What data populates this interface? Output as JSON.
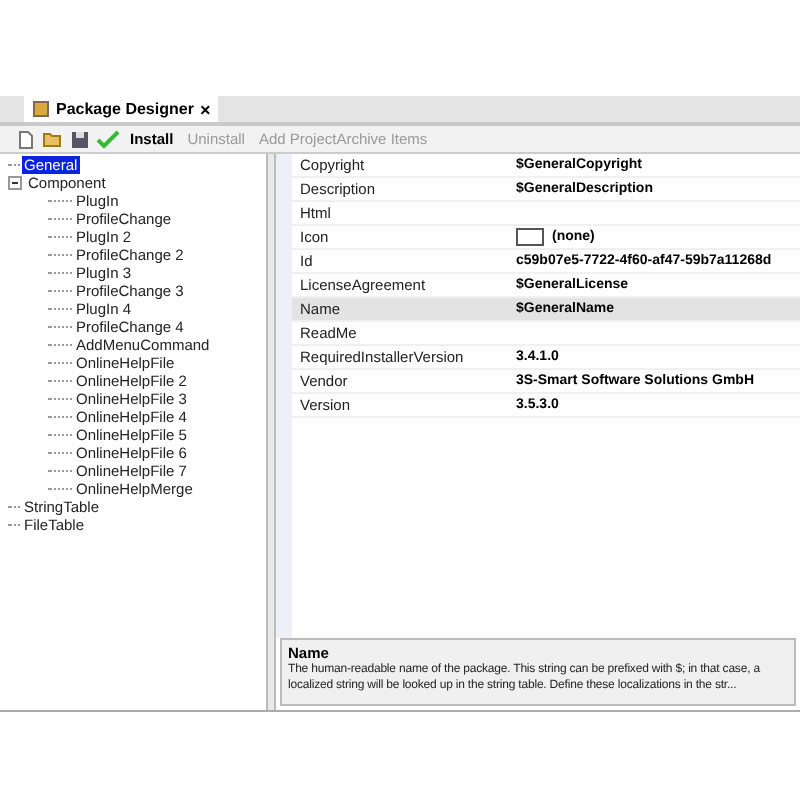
{
  "tab": {
    "title": "Package Designer",
    "close": "×"
  },
  "toolbar": [
    {
      "kind": "new",
      "disabled": false
    },
    {
      "kind": "open",
      "disabled": false
    },
    {
      "kind": "save",
      "disabled": false
    },
    {
      "kind": "check",
      "disabled": false
    },
    {
      "kind": "text",
      "label": "Install",
      "disabled": false
    },
    {
      "kind": "text",
      "label": "Uninstall",
      "disabled": true
    },
    {
      "kind": "text",
      "label": "Add ProjectArchive Items",
      "disabled": true
    }
  ],
  "tree": [
    {
      "label": "General",
      "selected": true
    },
    {
      "label": "Component",
      "selected": false,
      "expanded": true,
      "children": [
        {
          "label": "PlugIn",
          "selected": false
        },
        {
          "label": "ProfileChange",
          "selected": false
        },
        {
          "label": "PlugIn 2",
          "selected": false
        },
        {
          "label": "ProfileChange 2",
          "selected": false
        },
        {
          "label": "PlugIn 3",
          "selected": false
        },
        {
          "label": "ProfileChange 3",
          "selected": false
        },
        {
          "label": "PlugIn 4",
          "selected": false
        },
        {
          "label": "ProfileChange 4",
          "selected": false
        },
        {
          "label": "AddMenuCommand",
          "selected": false
        },
        {
          "label": "OnlineHelpFile",
          "selected": false
        },
        {
          "label": "OnlineHelpFile 2",
          "selected": false
        },
        {
          "label": "OnlineHelpFile 3",
          "selected": false
        },
        {
          "label": "OnlineHelpFile 4",
          "selected": false
        },
        {
          "label": "OnlineHelpFile 5",
          "selected": false
        },
        {
          "label": "OnlineHelpFile 6",
          "selected": false
        },
        {
          "label": "OnlineHelpFile 7",
          "selected": false
        },
        {
          "label": "OnlineHelpMerge",
          "selected": false
        }
      ]
    },
    {
      "label": "StringTable",
      "selected": false
    },
    {
      "label": "FileTable",
      "selected": false
    }
  ],
  "properties": [
    {
      "name": "Copyright",
      "value": "$GeneralCopyright",
      "selected": false
    },
    {
      "name": "Description",
      "value": "$GeneralDescription",
      "selected": false
    },
    {
      "name": "Html",
      "selected": false
    },
    {
      "name": "Icon",
      "value": "(none)",
      "kind": "icon",
      "selected": false
    },
    {
      "name": "Id",
      "value": "c59b07e5-7722-4f60-af47-59b7a11268d",
      "selected": false
    },
    {
      "name": "LicenseAgreement",
      "value": "$GeneralLicense",
      "selected": false
    },
    {
      "name": "Name",
      "value": "$GeneralName",
      "selected": true
    },
    {
      "name": "ReadMe",
      "selected": false
    },
    {
      "name": "RequiredInstallerVersion",
      "value": "3.4.1.0",
      "selected": false
    },
    {
      "name": "Vendor",
      "value": "3S-Smart Software Solutions GmbH",
      "selected": false
    },
    {
      "name": "Version",
      "value": "3.5.3.0",
      "selected": false
    }
  ],
  "description": {
    "title": "Name",
    "text": "The human-readable name of the package. This string can be prefixed with $; in that case, a localized string will be looked up in the string table. Define these localizations in the str..."
  }
}
